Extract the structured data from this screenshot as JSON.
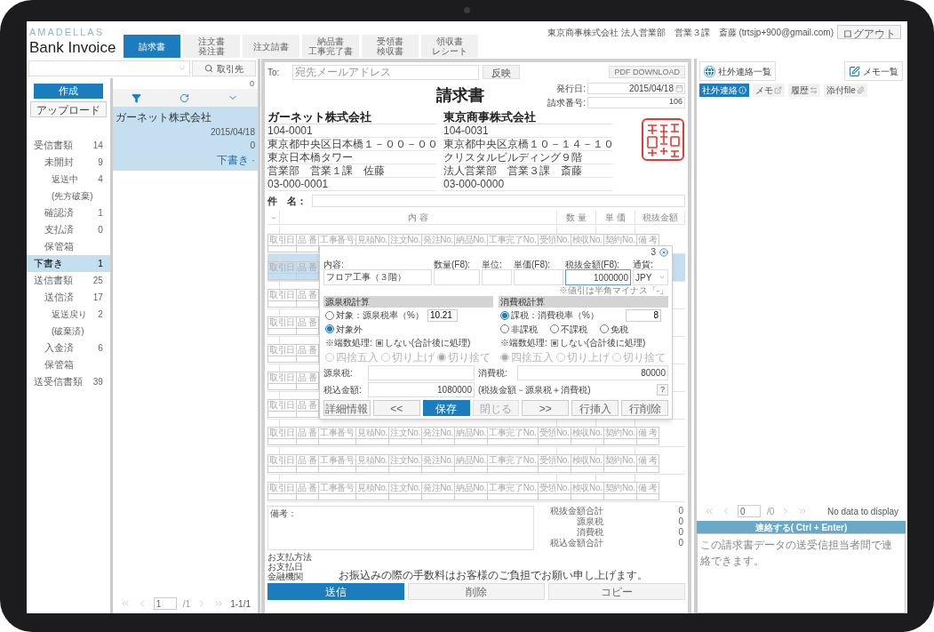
{
  "header": {
    "logo": "AMADELLAS",
    "title": "Bank Invoice",
    "tabs": [
      {
        "lines": [
          "請求書"
        ],
        "selected": true
      },
      {
        "lines": [
          "注文書",
          "発注書"
        ],
        "selected": false
      },
      {
        "lines": [
          "注文請書"
        ],
        "selected": false
      },
      {
        "lines": [
          "納品書",
          "工事完了書"
        ],
        "selected": false
      },
      {
        "lines": [
          "受領書",
          "検収書"
        ],
        "selected": false
      },
      {
        "lines": [
          "領収書",
          "レシート"
        ],
        "selected": false
      }
    ],
    "user": "東京商事株式会社 法人営業部　営業３課　斎藤 (trtsjp+900@gmail.com)",
    "logout": "ログアウト"
  },
  "search": {
    "partner_button": "取引先"
  },
  "sidebar": {
    "create": "作成",
    "upload": "アップロード",
    "items": [
      {
        "label": "受信書類",
        "count": "14",
        "selected": false,
        "children": [
          {
            "label": "未開封",
            "count": "9",
            "selected": false,
            "children": [
              {
                "label": "返送中",
                "count": "4",
                "selected": false
              },
              {
                "label": "(先方破棄)",
                "selected": false
              }
            ]
          },
          {
            "label": "確認済",
            "count": "1",
            "selected": false
          },
          {
            "label": "支払済",
            "count": "0",
            "selected": false
          },
          {
            "label": "保管箱",
            "selected": false
          }
        ]
      },
      {
        "label": "下書き",
        "count": "1",
        "selected": true
      },
      {
        "label": "送信書類",
        "count": "25",
        "selected": false,
        "children": [
          {
            "label": "送信済",
            "count": "17",
            "selected": false,
            "children": [
              {
                "label": "返送戻り",
                "count": "2",
                "selected": false
              },
              {
                "label": "(破棄済)",
                "selected": false
              }
            ]
          },
          {
            "label": "入金済",
            "count": "6",
            "selected": false
          },
          {
            "label": "保管箱",
            "selected": false
          }
        ]
      },
      {
        "label": "送受信書類",
        "count": "39",
        "selected": false
      }
    ]
  },
  "list": {
    "count": "0",
    "items": [
      {
        "company": "ガーネット株式会社",
        "date": "2015/04/18",
        "amount": "0",
        "status": "下書き ·",
        "selected": true
      }
    ],
    "pager": {
      "page": "1",
      "total": "/1",
      "range": "1-1/1"
    }
  },
  "document": {
    "to_label": "To:",
    "to_placeholder": "宛先メールアドレス",
    "apply": "反映",
    "pdf": "PDF DOWNLOAD",
    "title": "請求書",
    "issue_date_label": "発行日:",
    "issue_date": "2015/04/18",
    "number_label": "請求番号:",
    "number": "106",
    "sender": {
      "name": "ガーネット株式会社",
      "lines": [
        "104-0001",
        "東京都中央区日本橋１－００－００",
        "東京日本橋タワー",
        "営業部　営業１課　佐藤",
        "03-000-0001"
      ]
    },
    "recipient": {
      "name": "東京商事株式会社",
      "lines": [
        "104-0031",
        "東京都中央区京橋１０－１４－１０",
        "クリスタルビルディング９階",
        "法人営業部　営業３課　斎藤",
        "03-000-0000"
      ]
    },
    "subject_label": "件　名：",
    "columns": [
      "－",
      "内 容",
      "数 量",
      "単 価",
      "税抜金額"
    ],
    "line_items": [
      {
        "selected": false,
        "detail_headers": [
          "取引日",
          "品 番",
          "工事番号",
          "見積No.",
          "注文No.",
          "発注No.",
          "納品No.",
          "工事完了No.",
          "受領No.",
          "検収No.",
          "契約No.",
          "備 考"
        ]
      },
      {
        "selected": true,
        "detail_headers": [
          "取引日",
          "品 番"
        ]
      },
      {
        "selected": false,
        "detail_headers": [
          "取引日",
          "品 番"
        ]
      },
      {
        "selected": false,
        "detail_headers": [
          "取引日",
          "品 番"
        ]
      },
      {
        "selected": false,
        "detail_headers": [
          "取引日",
          "品 番"
        ]
      },
      {
        "selected": false,
        "detail_headers": [
          "取引日",
          "品 番"
        ]
      },
      {
        "selected": false,
        "detail_headers": [
          "取引日",
          "品 番"
        ]
      },
      {
        "selected": false,
        "detail_headers": [
          "取引日",
          "品 番",
          "工事番号",
          "見積No.",
          "注文No.",
          "発注No.",
          "納品No.",
          "工事完了No.",
          "受領No.",
          "検収No.",
          "契約No.",
          "備 考"
        ]
      },
      {
        "selected": false,
        "detail_headers": [
          "取引日",
          "品 番",
          "工事番号",
          "見積No.",
          "注文No.",
          "発注No.",
          "納品No.",
          "工事完了No.",
          "受領No.",
          "検収No.",
          "契約No.",
          "備 考"
        ]
      },
      {
        "selected": false,
        "detail_headers": [
          "取引日",
          "品 番",
          "工事番号",
          "見積No.",
          "注文No.",
          "発注No.",
          "納品No.",
          "工事完了No.",
          "受領No.",
          "検収No.",
          "契約No.",
          "備 考"
        ]
      }
    ],
    "editor": {
      "row_number": "3",
      "fields": [
        {
          "label": "内容:",
          "value": "フロア工事（３階）",
          "focused": false
        },
        {
          "label": "数量(F8):",
          "focused": false
        },
        {
          "label": "単位:",
          "focused": false
        },
        {
          "label": "単価(F8):",
          "focused": false
        },
        {
          "label": "税抜金額(F8):",
          "value": "1000000",
          "focused": true
        }
      ],
      "currency": {
        "label": "通貨:",
        "value": "JPY"
      },
      "hint": "※値引は半角マイナス「-」",
      "withholding": {
        "title": "源泉税計算",
        "options": [
          {
            "label": "対象：源泉税率（%）",
            "selected": false,
            "rate": "10.21"
          },
          {
            "label": "対象外",
            "selected": true
          }
        ],
        "rounding_label": "※端数処理:",
        "defer": {
          "label": "しない(合計後に処理)",
          "checked": true
        },
        "rounding": [
          {
            "label": "四捨五入",
            "selected": false
          },
          {
            "label": "切り上げ",
            "selected": false
          },
          {
            "label": "切り捨て",
            "selected": true
          }
        ]
      },
      "consumption": {
        "title": "消費税計算",
        "options": [
          {
            "label": "課税：消費税率（%）",
            "selected": true,
            "rate": "8"
          },
          {
            "label": "非課税",
            "selected": false
          },
          {
            "label": "不課税",
            "selected": false
          },
          {
            "label": "免税",
            "selected": false
          }
        ],
        "rounding_label": "※端数処理:",
        "defer": {
          "label": "しない(合計後に処理)",
          "checked": true
        },
        "rounding": [
          {
            "label": "四捨五入",
            "selected": true
          },
          {
            "label": "切り上げ",
            "selected": false
          },
          {
            "label": "切り捨て",
            "selected": false
          }
        ]
      },
      "withholding_tax": {
        "label": "源泉税:"
      },
      "consumption_tax": {
        "label": "消費税:",
        "value": "80000"
      },
      "total": {
        "label": "税込金額:",
        "value": "1080000",
        "formula": "(税抜金額－源泉税＋消費税)"
      },
      "help": "?",
      "buttons": [
        {
          "label": "詳細情報",
          "kind": "plain"
        },
        {
          "label": "<<",
          "kind": "plain"
        },
        {
          "label": "保存",
          "kind": "primary"
        },
        {
          "label": "閉じる",
          "kind": "muted"
        },
        {
          "label": ">>",
          "kind": "plain"
        },
        {
          "label": "行挿入",
          "kind": "plain"
        },
        {
          "label": "行削除",
          "kind": "plain"
        }
      ]
    },
    "note_label": "備考：",
    "totals": [
      {
        "label": "税抜金額合計",
        "value": "0"
      },
      {
        "label": "源泉税",
        "value": "0"
      },
      {
        "label": "消費税",
        "value": "0"
      },
      {
        "label": "税込金額合計",
        "value": "0"
      }
    ],
    "payment": [
      "お支払方法",
      "お支払日",
      "金融機関"
    ],
    "fee_note": "お振込みの際の手数料はお客様のご負担でお願い申し上げます。",
    "actions": [
      {
        "label": "送信",
        "kind": "primary"
      },
      {
        "label": "削除",
        "kind": "plain"
      },
      {
        "label": "コピー",
        "kind": "plain"
      }
    ]
  },
  "side_panel": {
    "contacts_button": "社外連絡一覧",
    "memo_button": "メモ一覧",
    "tabs": [
      {
        "label": "社外連絡",
        "kind": "info",
        "selected": true
      },
      {
        "label": "メモ",
        "kind": "edit",
        "selected": false
      },
      {
        "label": "履歴",
        "kind": "swap",
        "selected": false
      },
      {
        "label": "添付file",
        "kind": "clip",
        "selected": false
      }
    ],
    "pager": {
      "page": "0",
      "total": "/0",
      "status": "No data to display"
    },
    "compose": {
      "title": "連絡する( Ctrl + Enter)",
      "placeholder": "この請求書データの送受信担当者間で連絡できます。"
    }
  }
}
